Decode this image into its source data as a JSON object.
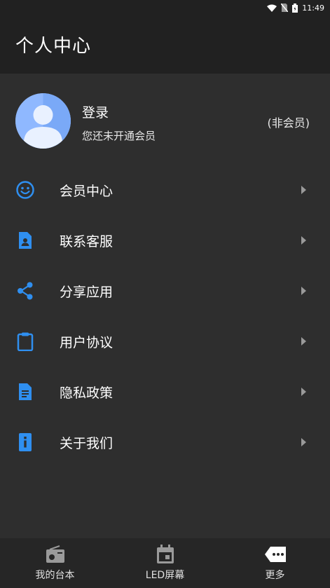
{
  "status_bar": {
    "time": "11:49"
  },
  "header": {
    "title": "个人中心"
  },
  "profile": {
    "login_title": "登录",
    "subtitle": "您还未开通会员",
    "member_status": "(非会员)"
  },
  "menu": [
    {
      "label": "会员中心",
      "icon": "smiley-icon"
    },
    {
      "label": "联系客服",
      "icon": "contact-card-icon"
    },
    {
      "label": "分享应用",
      "icon": "share-icon"
    },
    {
      "label": "用户协议",
      "icon": "clipboard-icon"
    },
    {
      "label": "隐私政策",
      "icon": "document-icon"
    },
    {
      "label": "关于我们",
      "icon": "info-icon"
    }
  ],
  "bottom_nav": [
    {
      "label": "我的台本",
      "icon": "radio-icon"
    },
    {
      "label": "LED屏幕",
      "icon": "calendar-icon"
    },
    {
      "label": "更多",
      "icon": "more-icon"
    }
  ],
  "colors": {
    "accent": "#2f8ff0",
    "background": "#2e2e2e",
    "header": "#212121"
  }
}
